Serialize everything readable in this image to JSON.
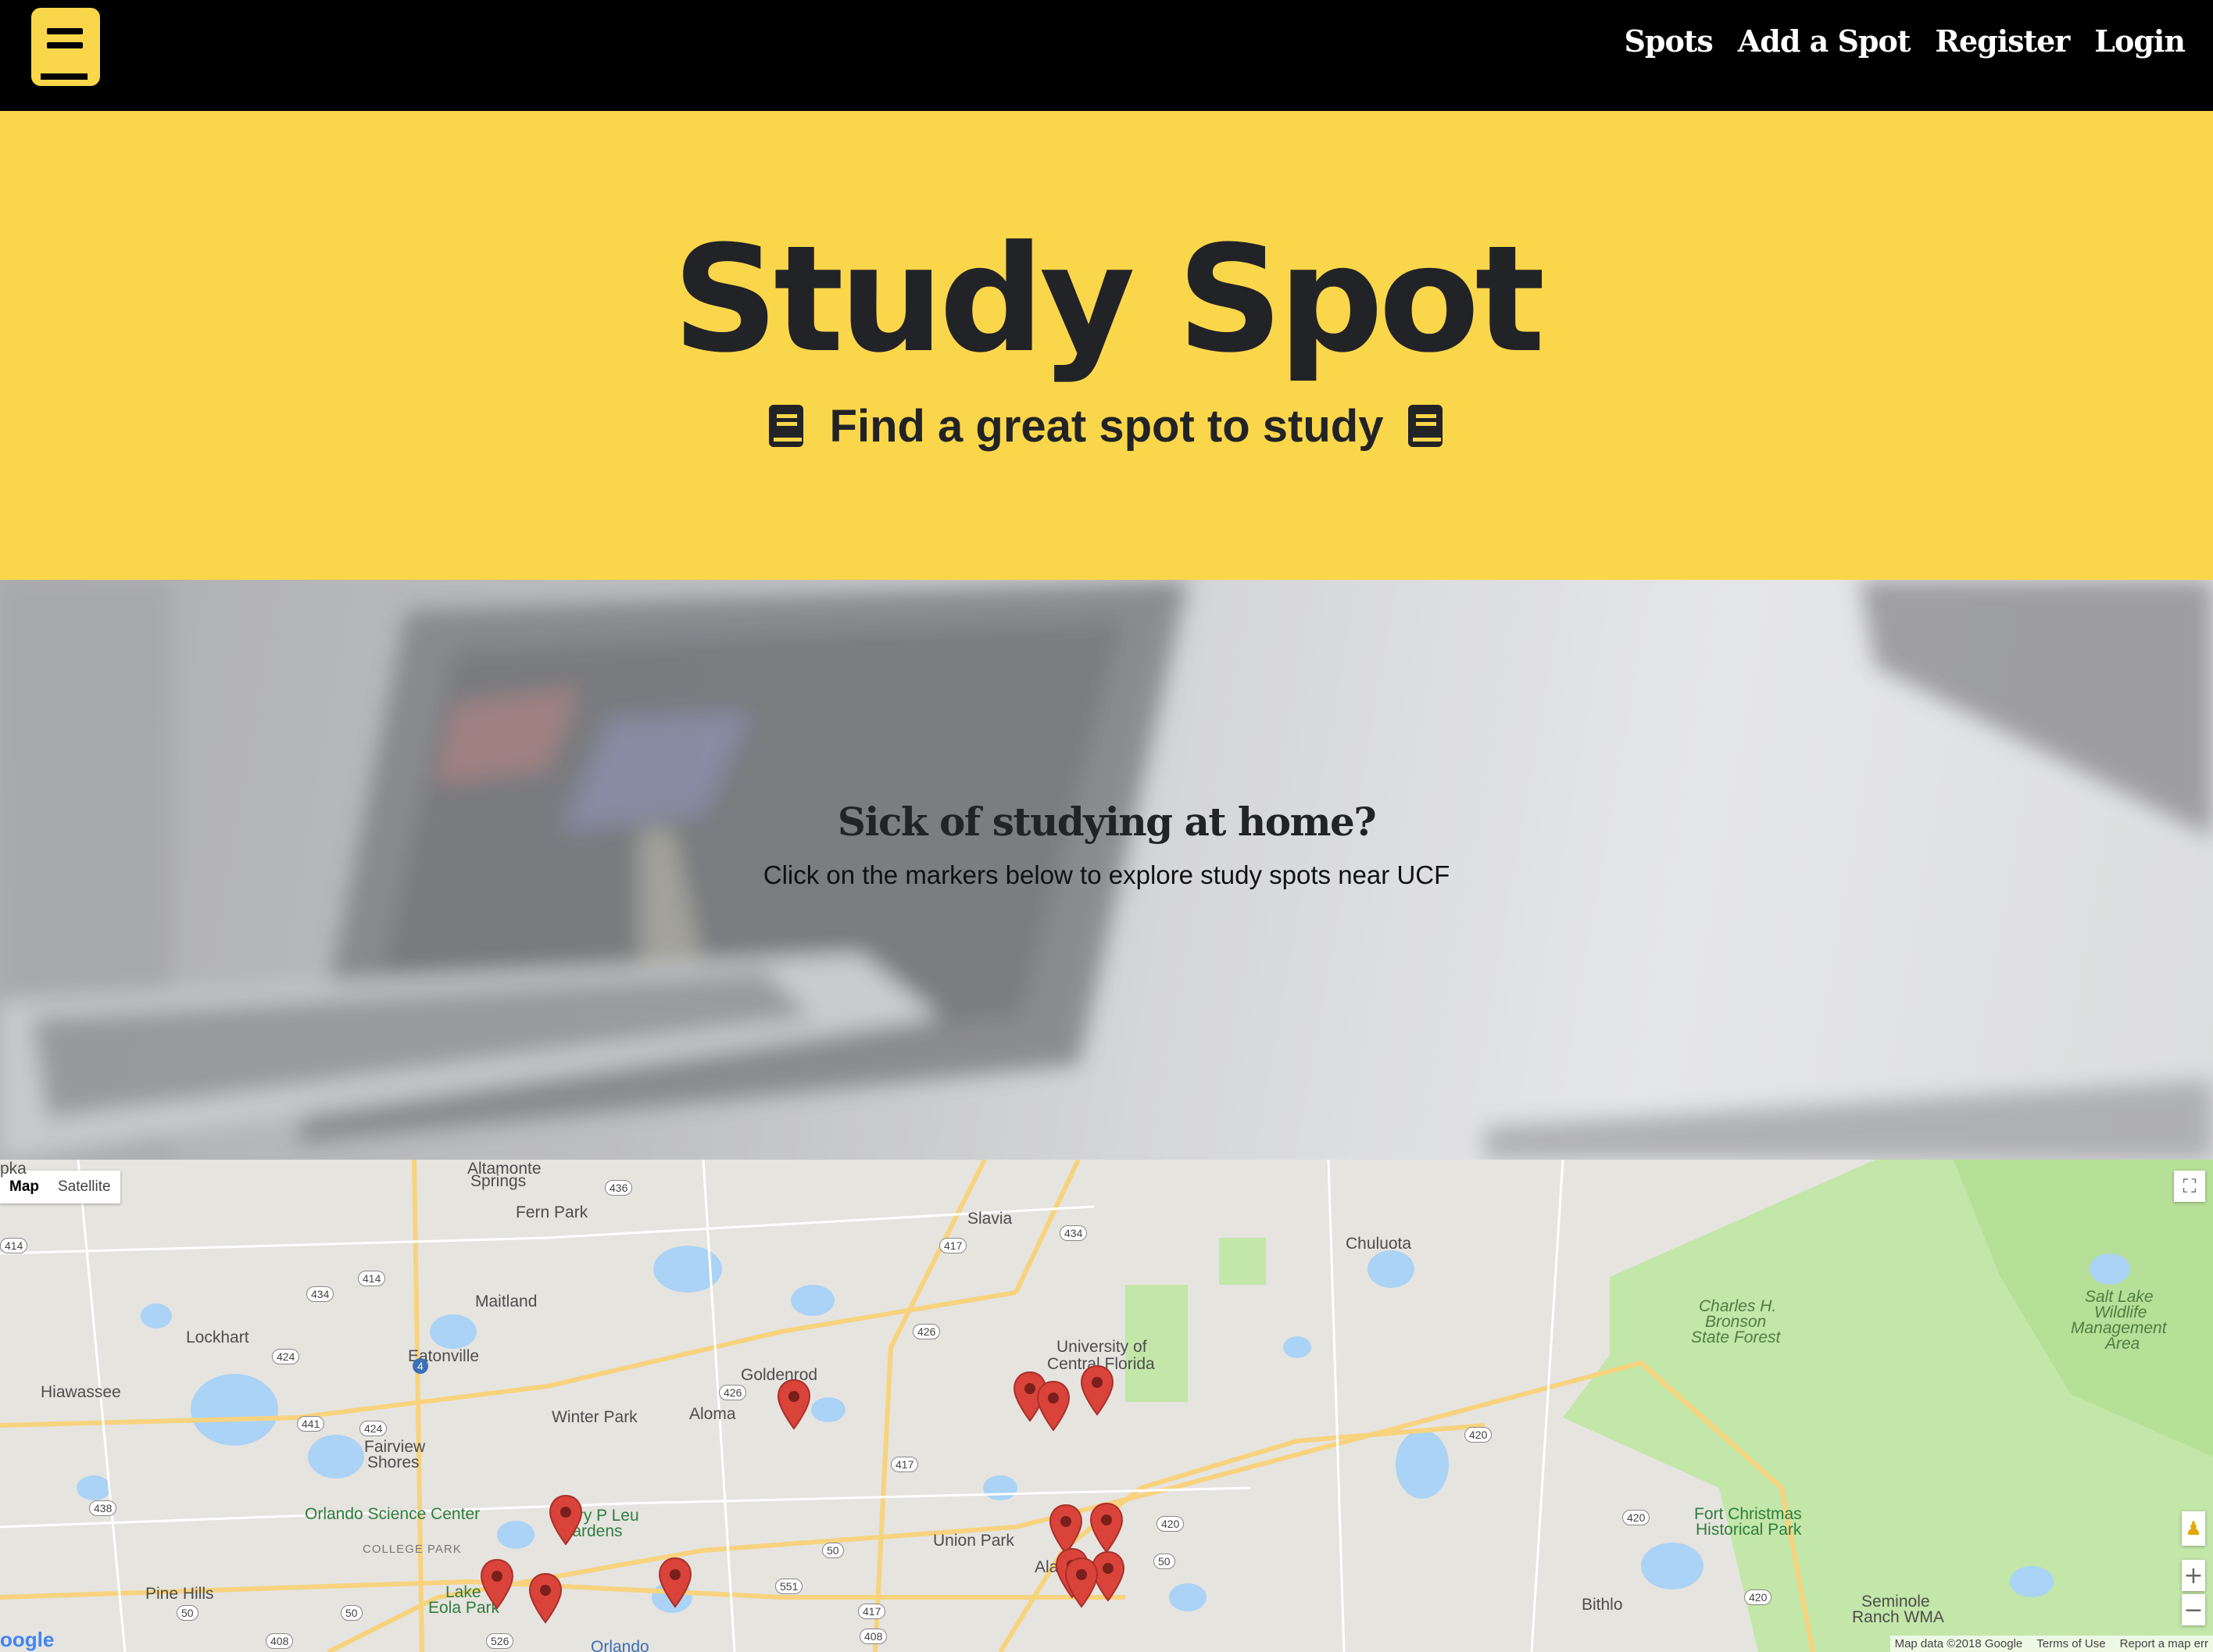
{
  "nav": {
    "links": [
      "Spots",
      "Add a Spot",
      "Register",
      "Login"
    ],
    "colors": {
      "background": "#000000",
      "text": "#ffffff",
      "brand": "#fad64a"
    }
  },
  "hero": {
    "title": "Study Spot",
    "subtitle": "Find a great spot to study",
    "background": "#fad64a",
    "icon": "book-icon"
  },
  "intro": {
    "heading": "Sick of studying at home?",
    "text": "Click on the markers below to explore study spots near UCF"
  },
  "map": {
    "type_controls": [
      "Map",
      "Satellite"
    ],
    "active_type": "Map",
    "places": {
      "apopka": "pka",
      "altamonte": "Altamonte",
      "springs": "Springs",
      "fern_park": "Fern Park",
      "slavia": "Slavia",
      "chuluota": "Chuluota",
      "maitland": "Maitland",
      "lockhart": "Lockhart",
      "eatonville": "Eatonville",
      "hiawassee": "Hiawassee",
      "goldenrod": "Goldenrod",
      "aloma": "Aloma",
      "winter_park": "Winter Park",
      "fairview": "Fairview",
      "shores": "Shores",
      "ucf_1": "University of",
      "ucf_2": "Central Florida",
      "osc": "Orlando Science Center",
      "leu_1": "Harry P Leu",
      "leu_2": "Gardens",
      "college_park": "COLLEGE PARK",
      "union_park": "Union Park",
      "alafaya": "Ala",
      "pine_hills": "Pine Hills",
      "lake_eola_1": "Lake",
      "lake_eola_2": "Eola Park",
      "orlando": "Orlando",
      "bithlo": "Bithlo",
      "charles_1": "Charles H.",
      "charles_2": "Bronson",
      "charles_3": "State Forest",
      "salt_1": "Salt Lake",
      "salt_2": "Wildlife",
      "salt_3": "Management",
      "salt_4": "Area",
      "fort_1": "Fort Christmas",
      "fort_2": "Historical Park",
      "seminole_1": "Seminole",
      "seminole_2": "Ranch WMA"
    },
    "routes": {
      "r436": "436",
      "r414a": "414",
      "r417a": "417",
      "r434a": "434",
      "r434b": "434",
      "r426a": "426",
      "r426b": "426",
      "r424a": "424",
      "r424b": "424",
      "r441": "441",
      "r414b": "414",
      "r438": "438",
      "r420a": "420",
      "r420b": "420",
      "r420c": "420",
      "r420d": "420",
      "r417b": "417",
      "r417c": "417",
      "r50a": "50",
      "r50b": "50",
      "r50c": "50",
      "r50d": "50",
      "r551": "551",
      "r408a": "408",
      "r408b": "408",
      "r526": "526",
      "r4": "4"
    },
    "footer": {
      "data": "Map data ©2018 Google",
      "terms": "Terms of Use",
      "report": "Report a map err"
    },
    "logo": "oogle",
    "marker_color": "#d9433a",
    "water_color": "#aad3f5",
    "forest_color": "#c3e6a9",
    "road_color": "#f7d37e"
  }
}
